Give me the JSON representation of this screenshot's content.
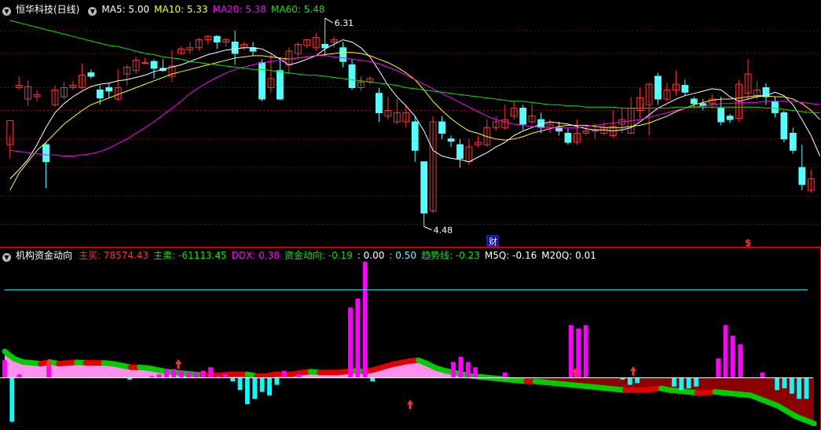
{
  "colors": {
    "bg": "#000000",
    "up": "#ff3232",
    "down": "#54ffff",
    "ma5": "#ffffff",
    "ma10": "#ffff00",
    "ma20": "#ff00ff",
    "ma60": "#00e600",
    "grid": "#8b0000",
    "divider": "#ff0000",
    "sell_fill": "#8b0000",
    "buy_fill": "#ff90ee",
    "bar_pos": "#ff00ff",
    "bar_neg": "#00ffff",
    "level_line": "#00ffff",
    "ribbon_up": "#e00000",
    "ribbon_down": "#00cc00"
  },
  "top_panel": {
    "title": "恒华科技(日线)",
    "legend": [
      {
        "label": "MA5: 5.00",
        "color": "#ffffff"
      },
      {
        "label": "MA10: 5.33",
        "color": "#ffff00"
      },
      {
        "label": "MA20: 5.38",
        "color": "#ff00ff"
      },
      {
        "label": "MA60: 5.48",
        "color": "#00e600"
      }
    ],
    "high_label": "6.31",
    "low_label": "4.48",
    "markers": {
      "finance": "财",
      "dollar": "$"
    }
  },
  "bottom_panel": {
    "title": "机构资金动向",
    "legend": [
      {
        "label": "主买: 78574.43",
        "color": "#ff3232"
      },
      {
        "label": "主卖: -61113.45",
        "color": "#00e600"
      },
      {
        "label": "DDX: 0.38",
        "color": "#ff00ff"
      },
      {
        "label": "资金动向: -0.19",
        "color": "#00e600"
      },
      {
        "label": ": 0.00",
        "color": "#ffffff"
      },
      {
        "label": ": 0.50",
        "color": "#54ffff"
      },
      {
        "label": "趋势线: -0.23",
        "color": "#00e600"
      },
      {
        "label": "M5Q: -0.16",
        "color": "#ffffff"
      },
      {
        "label": "M20Q: 0.01",
        "color": "#ffffff"
      }
    ]
  },
  "chart_data": [
    {
      "type": "candlestick",
      "title": "恒华科技(日线)",
      "price_range": [
        4.48,
        6.31
      ],
      "candles": [
        [
          5.2,
          5.41,
          5.28,
          5.08
        ],
        [
          5.7,
          5.72,
          5.8,
          5.68
        ],
        [
          5.6,
          5.71,
          5.76,
          5.54
        ],
        [
          5.62,
          5.64,
          5.68,
          5.58
        ],
        [
          5.2,
          5.05,
          5.22,
          4.82
        ],
        [
          5.55,
          5.68,
          5.72,
          5.53
        ],
        [
          5.62,
          5.7,
          5.75,
          5.6
        ],
        [
          5.7,
          5.72,
          5.76,
          5.68
        ],
        [
          5.7,
          5.81,
          5.91,
          5.68
        ],
        [
          5.83,
          5.8,
          5.86,
          5.78
        ],
        [
          5.68,
          5.61,
          5.72,
          5.55
        ],
        [
          5.7,
          5.67,
          5.74,
          5.61
        ],
        [
          5.6,
          5.7,
          5.86,
          5.58
        ],
        [
          5.82,
          5.88,
          5.9,
          5.72
        ],
        [
          5.85,
          5.94,
          5.97,
          5.82
        ],
        [
          5.92,
          5.92,
          5.96,
          5.91
        ],
        [
          5.93,
          5.87,
          5.95,
          5.78
        ],
        [
          5.87,
          5.85,
          5.95,
          5.84
        ],
        [
          5.8,
          5.89,
          6.03,
          5.75
        ],
        [
          6.0,
          6.04,
          6.06,
          5.99
        ],
        [
          6.03,
          6.05,
          6.1,
          6.0
        ],
        [
          6.05,
          6.12,
          6.14,
          6.02
        ],
        [
          6.12,
          6.15,
          6.16,
          6.08
        ],
        [
          6.15,
          6.1,
          6.16,
          6.04
        ],
        [
          6.1,
          6.12,
          6.14,
          6.06
        ],
        [
          6.1,
          6.0,
          6.2,
          5.9
        ],
        [
          6.05,
          6.08,
          6.1,
          6.03
        ],
        [
          6.05,
          6.02,
          6.1,
          5.98
        ],
        [
          5.92,
          5.6,
          5.95,
          5.58
        ],
        [
          5.7,
          5.78,
          6.0,
          5.66
        ],
        [
          5.85,
          5.6,
          5.96,
          5.59
        ],
        [
          5.9,
          6.02,
          6.05,
          5.82
        ],
        [
          6.0,
          6.08,
          6.1,
          5.96
        ],
        [
          6.07,
          6.12,
          6.12,
          6.05
        ],
        [
          6.05,
          6.14,
          6.18,
          6.02
        ],
        [
          6.08,
          6.05,
          6.31,
          5.98
        ],
        [
          6.1,
          6.12,
          6.15,
          6.05
        ],
        [
          6.05,
          5.93,
          6.1,
          5.88
        ],
        [
          5.9,
          5.7,
          5.95,
          5.68
        ],
        [
          5.7,
          5.75,
          5.8,
          5.67
        ],
        [
          5.75,
          5.78,
          5.8,
          5.73
        ],
        [
          5.65,
          5.48,
          5.7,
          5.4
        ],
        [
          5.45,
          5.5,
          5.62,
          5.42
        ],
        [
          5.4,
          5.48,
          5.6,
          5.38
        ],
        [
          5.4,
          5.48,
          5.55,
          5.35
        ],
        [
          5.4,
          5.15,
          5.45,
          5.05
        ],
        [
          5.05,
          4.6,
          5.05,
          4.48
        ],
        [
          4.62,
          5.4,
          5.45,
          4.6
        ],
        [
          5.4,
          5.3,
          5.45,
          5.25
        ],
        [
          5.25,
          5.23,
          5.28,
          5.18
        ],
        [
          5.2,
          5.08,
          5.25,
          5.0
        ],
        [
          5.05,
          5.18,
          5.25,
          5.02
        ],
        [
          5.2,
          5.22,
          5.28,
          5.18
        ],
        [
          5.2,
          5.35,
          5.42,
          5.18
        ],
        [
          5.35,
          5.4,
          5.45,
          5.32
        ],
        [
          5.35,
          5.42,
          5.55,
          5.33
        ],
        [
          5.45,
          5.52,
          5.58,
          5.42
        ],
        [
          5.52,
          5.38,
          5.55,
          5.33
        ],
        [
          5.4,
          5.45,
          5.55,
          5.38
        ],
        [
          5.42,
          5.35,
          5.48,
          5.3
        ],
        [
          5.35,
          5.38,
          5.42,
          5.3
        ],
        [
          5.35,
          5.32,
          5.4,
          5.28
        ],
        [
          5.3,
          5.22,
          5.35,
          5.2
        ],
        [
          5.22,
          5.3,
          5.42,
          5.2
        ],
        [
          5.3,
          5.32,
          5.36,
          5.28
        ],
        [
          5.32,
          5.33,
          5.38,
          5.25
        ],
        [
          5.3,
          5.35,
          5.4,
          5.28
        ],
        [
          5.28,
          5.36,
          5.5,
          5.26
        ],
        [
          5.38,
          5.42,
          5.52,
          5.3
        ],
        [
          5.3,
          5.52,
          5.62,
          5.3
        ],
        [
          5.5,
          5.61,
          5.7,
          5.43
        ],
        [
          5.55,
          5.73,
          5.74,
          5.28
        ],
        [
          5.8,
          5.6,
          5.83,
          5.55
        ],
        [
          5.6,
          5.68,
          5.74,
          5.58
        ],
        [
          5.68,
          5.73,
          5.85,
          5.63
        ],
        [
          5.72,
          5.66,
          5.77,
          5.63
        ],
        [
          5.6,
          5.56,
          5.62,
          5.52
        ],
        [
          5.56,
          5.54,
          5.6,
          5.5
        ],
        [
          5.56,
          5.6,
          5.64,
          5.52
        ],
        [
          5.52,
          5.4,
          5.62,
          5.37
        ],
        [
          5.45,
          5.42,
          5.47,
          5.39
        ],
        [
          5.43,
          5.73,
          5.77,
          5.4
        ],
        [
          5.65,
          5.82,
          5.95,
          5.6
        ],
        [
          5.63,
          5.68,
          5.76,
          5.6
        ],
        [
          5.7,
          5.62,
          5.74,
          5.55
        ],
        [
          5.58,
          5.48,
          5.62,
          5.44
        ],
        [
          5.48,
          5.25,
          5.5,
          5.22
        ],
        [
          5.3,
          5.15,
          5.35,
          5.12
        ],
        [
          5.0,
          4.85,
          5.2,
          4.8
        ],
        [
          4.8,
          4.9,
          4.98,
          4.78
        ]
      ],
      "moving_averages": {
        "MA5": [
          4.9,
          4.98,
          5.07,
          5.2,
          5.35,
          5.48,
          5.56,
          5.62,
          5.67,
          5.71,
          5.73,
          5.74,
          5.76,
          5.77,
          5.79,
          5.81,
          5.84,
          5.86,
          5.88,
          5.9,
          5.93,
          5.96,
          5.99,
          6.01,
          6.03,
          6.04,
          6.05,
          6.05,
          6.04,
          6.0,
          5.95,
          5.9,
          5.92,
          5.95,
          5.98,
          6.04,
          6.08,
          6.12,
          6.1,
          6.05,
          5.97,
          5.85,
          5.72,
          5.62,
          5.54,
          5.45,
          5.32,
          5.15,
          5.1,
          5.08,
          5.07,
          5.05,
          5.09,
          5.13,
          5.18,
          5.22,
          5.28,
          5.32,
          5.35,
          5.38,
          5.4,
          5.39,
          5.38,
          5.36,
          5.34,
          5.33,
          5.33,
          5.32,
          5.33,
          5.35,
          5.4,
          5.46,
          5.52,
          5.56,
          5.6,
          5.63,
          5.65,
          5.67,
          5.69,
          5.68,
          5.62,
          5.58,
          5.6,
          5.62,
          5.63,
          5.66,
          5.63,
          5.55,
          5.42,
          5.28,
          5.1
        ],
        "MA10": [
          4.8,
          4.95,
          5.05,
          5.15,
          5.22,
          5.3,
          5.38,
          5.44,
          5.5,
          5.55,
          5.58,
          5.61,
          5.64,
          5.67,
          5.7,
          5.73,
          5.76,
          5.79,
          5.82,
          5.84,
          5.86,
          5.88,
          5.9,
          5.92,
          5.94,
          5.96,
          5.97,
          5.98,
          5.98,
          5.97,
          5.96,
          5.95,
          5.96,
          5.97,
          5.98,
          5.99,
          6.0,
          6.01,
          6.01,
          6.0,
          5.98,
          5.95,
          5.92,
          5.88,
          5.83,
          5.77,
          5.68,
          5.58,
          5.5,
          5.43,
          5.37,
          5.32,
          5.3,
          5.27,
          5.25,
          5.24,
          5.25,
          5.27,
          5.3,
          5.32,
          5.34,
          5.36,
          5.37,
          5.37,
          5.37,
          5.36,
          5.35,
          5.35,
          5.35,
          5.36,
          5.37,
          5.39,
          5.42,
          5.45,
          5.49,
          5.52,
          5.55,
          5.57,
          5.59,
          5.6,
          5.6,
          5.61,
          5.62,
          5.63,
          5.63,
          5.62,
          5.62,
          5.6,
          5.56,
          5.5,
          5.42
        ],
        "MA20": [
          5.15,
          5.14,
          5.13,
          5.12,
          5.11,
          5.11,
          5.1,
          5.1,
          5.11,
          5.12,
          5.14,
          5.17,
          5.21,
          5.25,
          5.3,
          5.35,
          5.4,
          5.46,
          5.52,
          5.58,
          5.65,
          5.7,
          5.75,
          5.79,
          5.83,
          5.86,
          5.88,
          5.9,
          5.92,
          5.93,
          5.94,
          5.95,
          5.96,
          5.97,
          5.98,
          5.98,
          5.97,
          5.96,
          5.95,
          5.94,
          5.93,
          5.91,
          5.88,
          5.85,
          5.81,
          5.77,
          5.73,
          5.69,
          5.65,
          5.61,
          5.57,
          5.53,
          5.49,
          5.45,
          5.42,
          5.4,
          5.38,
          5.37,
          5.36,
          5.35,
          5.35,
          5.35,
          5.35,
          5.35,
          5.36,
          5.37,
          5.38,
          5.39,
          5.4,
          5.41,
          5.42,
          5.44,
          5.46,
          5.48,
          5.5,
          5.52,
          5.53,
          5.54,
          5.55,
          5.56,
          5.56,
          5.57,
          5.57,
          5.57,
          5.58,
          5.58,
          5.58,
          5.58,
          5.57,
          5.56,
          5.55
        ],
        "MA60": [
          6.29,
          6.27,
          6.25,
          6.23,
          6.21,
          6.19,
          6.17,
          6.15,
          6.13,
          6.11,
          6.09,
          6.07,
          6.06,
          6.04,
          6.02,
          6.0,
          5.99,
          5.97,
          5.96,
          5.95,
          5.93,
          5.92,
          5.91,
          5.9,
          5.89,
          5.88,
          5.87,
          5.86,
          5.86,
          5.85,
          5.84,
          5.83,
          5.82,
          5.81,
          5.81,
          5.8,
          5.79,
          5.78,
          5.77,
          5.76,
          5.75,
          5.74,
          5.73,
          5.72,
          5.7,
          5.69,
          5.68,
          5.67,
          5.66,
          5.65,
          5.64,
          5.63,
          5.62,
          5.61,
          5.6,
          5.59,
          5.58,
          5.58,
          5.57,
          5.56,
          5.55,
          5.55,
          5.54,
          5.54,
          5.53,
          5.53,
          5.53,
          5.53,
          5.52,
          5.52,
          5.52,
          5.52,
          5.52,
          5.52,
          5.53,
          5.53,
          5.53,
          5.53,
          5.53,
          5.53,
          5.53,
          5.53,
          5.53,
          5.53,
          5.52,
          5.52,
          5.51,
          5.5,
          5.49,
          5.48,
          5.48
        ]
      }
    },
    {
      "type": "bar",
      "title": "机构资金动向",
      "value_range": [
        -0.27,
        0.66
      ],
      "ddx_bars": [
        0.1,
        -0.25,
        0.02,
        0,
        0,
        0,
        0.09,
        0,
        0,
        0,
        0,
        0,
        0,
        0,
        0,
        0,
        0,
        -0.01,
        0,
        0,
        0.01,
        0.02,
        0.05,
        0.05,
        0.04,
        0.03,
        0.03,
        0.04,
        0.06,
        0.01,
        0.02,
        -0.02,
        -0.07,
        -0.15,
        -0.12,
        -0.08,
        -0.1,
        -0.04,
        0.04,
        0,
        0.02,
        0,
        0,
        0,
        0,
        0,
        0,
        0.4,
        0.45,
        0.66,
        -0.02,
        0,
        0,
        0,
        0,
        0,
        0,
        0,
        0,
        0,
        0,
        0.09,
        0.12,
        0.09,
        0.06,
        0,
        0,
        0,
        0.03,
        0,
        0,
        0,
        0,
        0,
        0,
        0,
        0,
        0.3,
        0.28,
        0.3,
        0,
        0,
        0,
        0,
        -0.01,
        -0.04,
        -0.03,
        0,
        0,
        0,
        0,
        -0.05,
        -0.07,
        -0.06,
        -0.05,
        0,
        0,
        0.11,
        0.3,
        0.24,
        0.19,
        0,
        0,
        0.03,
        0,
        -0.07,
        -0.06,
        -0.09,
        -0.12,
        -0.12
      ],
      "trend_line": [
        0.15,
        0.11,
        0.09,
        0.085,
        0.08,
        0.09,
        0.08,
        0.085,
        0.088,
        0.085,
        0.085,
        0.085,
        0.08,
        0.07,
        0.06,
        0.06,
        0.055,
        0.045,
        0.035,
        0.03,
        0.025,
        0.02,
        0.015,
        0.015,
        0.015,
        0.02,
        0.02,
        0.02,
        0.01,
        0.01,
        0.02,
        0.02,
        0.02,
        0.03,
        0.035,
        0.03,
        0.03,
        0.03,
        0.035,
        0.04,
        0.035,
        0.045,
        0.06,
        0.075,
        0.085,
        0.095,
        0.1,
        0.08,
        0.055,
        0.04,
        0.03,
        0.02,
        0.01,
        0.005,
        0.0,
        -0.005,
        -0.01,
        -0.015,
        -0.02,
        -0.02,
        -0.025,
        -0.03,
        -0.035,
        -0.04,
        -0.045,
        -0.05,
        -0.055,
        -0.06,
        -0.065,
        -0.07,
        -0.07,
        -0.07,
        -0.065,
        -0.06,
        -0.07,
        -0.075,
        -0.08,
        -0.085,
        -0.085,
        -0.08,
        -0.085,
        -0.09,
        -0.095,
        -0.1,
        -0.12,
        -0.14,
        -0.16,
        -0.19,
        -0.22,
        -0.24,
        -0.26
      ]
    }
  ]
}
